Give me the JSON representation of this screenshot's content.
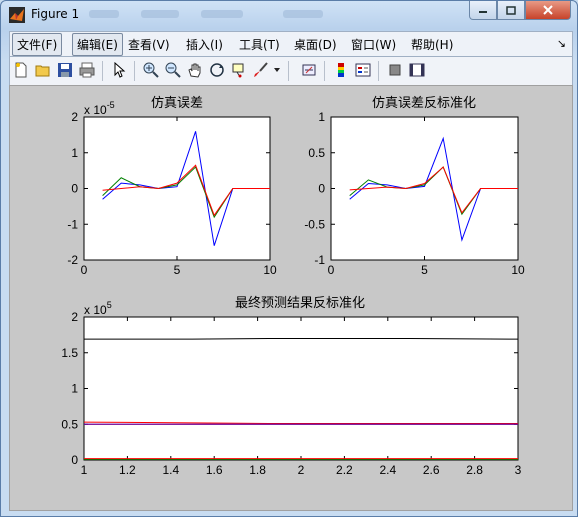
{
  "window": {
    "title": "Figure 1"
  },
  "menu": {
    "items": [
      "文件(F)",
      "编辑(E)",
      "查看(V)",
      "插入(I)",
      "工具(T)",
      "桌面(D)",
      "窗口(W)",
      "帮助(H)"
    ]
  },
  "toolbar": {
    "icons": [
      "new-figure-icon",
      "open-file-icon",
      "save-icon",
      "print-icon",
      "pointer-icon",
      "zoom-in-icon",
      "zoom-out-icon",
      "pan-hand-icon",
      "rotate-3d-icon",
      "data-cursor-icon",
      "brush-icon",
      "link-plot-icon",
      "colorbar-icon",
      "legend-icon",
      "hide-plot-tools-icon",
      "show-plot-tools-icon"
    ]
  },
  "chart_data": [
    {
      "type": "line",
      "title": "仿真误差",
      "exponent_label": "x 10",
      "exponent": "-5",
      "xlim": [
        0,
        10
      ],
      "ylim": [
        -2,
        2
      ],
      "xticks": [
        "0",
        "5",
        "10"
      ],
      "yticks": [
        "2",
        "1",
        "0",
        "-1",
        "-2"
      ],
      "x": [
        1,
        2,
        3,
        4,
        5,
        6,
        7,
        8,
        9,
        10
      ],
      "series": [
        {
          "color": "#0000ff",
          "values": [
            -0.3,
            0.15,
            0.1,
            0.0,
            0.05,
            1.6,
            -1.6,
            0,
            0,
            0
          ]
        },
        {
          "color": "#008000",
          "values": [
            -0.2,
            0.3,
            0.05,
            0.0,
            0.1,
            0.6,
            -0.8,
            0,
            0,
            0
          ]
        },
        {
          "color": "#ff0000",
          "values": [
            -0.05,
            0.0,
            0.05,
            0.0,
            0.15,
            0.65,
            -0.75,
            0,
            0,
            0
          ]
        }
      ]
    },
    {
      "type": "line",
      "title": "仿真误差反标准化",
      "xlim": [
        0,
        10
      ],
      "ylim": [
        -1,
        1
      ],
      "xticks": [
        "0",
        "5",
        "10"
      ],
      "yticks": [
        "1",
        "0.5",
        "0",
        "-0.5",
        "-1"
      ],
      "x": [
        1,
        2,
        3,
        4,
        5,
        6,
        7,
        8,
        9,
        10
      ],
      "series": [
        {
          "color": "#0000ff",
          "values": [
            -0.15,
            0.07,
            0.05,
            0.0,
            0.03,
            0.7,
            -0.72,
            0,
            0,
            0
          ]
        },
        {
          "color": "#008000",
          "values": [
            -0.1,
            0.12,
            0.02,
            0.0,
            0.05,
            0.3,
            -0.36,
            0,
            0,
            0
          ]
        },
        {
          "color": "#ff0000",
          "values": [
            -0.02,
            0.0,
            0.02,
            0.0,
            0.07,
            0.3,
            -0.34,
            0,
            0,
            0
          ]
        }
      ]
    },
    {
      "type": "line",
      "title": "最终预测结果反标准化",
      "exponent_label": "x 10",
      "exponent": "5",
      "xlim": [
        1,
        3
      ],
      "ylim": [
        0,
        2
      ],
      "xticks": [
        "1",
        "1.2",
        "1.4",
        "1.6",
        "1.8",
        "2",
        "2.2",
        "2.4",
        "2.6",
        "2.8",
        "3"
      ],
      "yticks": [
        "2",
        "1.5",
        "1",
        "0.5",
        "0"
      ],
      "x": [
        1,
        1.5,
        1.85,
        2.5,
        3
      ],
      "series": [
        {
          "color": "#000000",
          "values": [
            1.69,
            1.69,
            1.7,
            1.7,
            1.69
          ]
        },
        {
          "color": "#ff0000",
          "values": [
            0.53,
            0.52,
            0.51,
            0.51,
            0.51
          ]
        },
        {
          "color": "#0000ff",
          "values": [
            0.5,
            0.5,
            0.5,
            0.5,
            0.5
          ]
        },
        {
          "color": "#800080",
          "values": [
            0.5,
            0.5,
            0.5,
            0.5,
            0.5
          ]
        },
        {
          "color": "#00a000",
          "values": [
            0.01,
            0.01,
            0.01,
            0.01,
            0.01
          ]
        },
        {
          "color": "#ff0000",
          "values": [
            0.02,
            0.02,
            0.02,
            0.02,
            0.02
          ]
        }
      ]
    }
  ]
}
